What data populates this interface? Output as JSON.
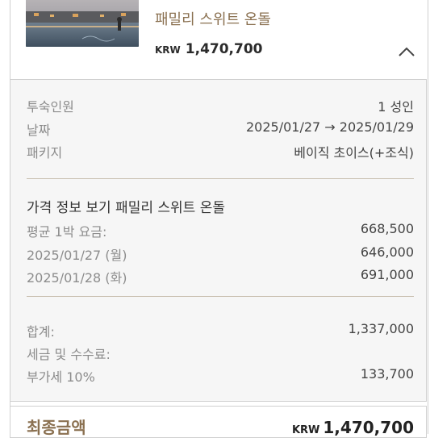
{
  "room": {
    "name": "패밀리 스위트 온돌",
    "currency": "KRW",
    "price": "1,470,700"
  },
  "summary": {
    "guests_label": "투숙인원",
    "guests_value": "1 성인",
    "date_label": "날짜",
    "date_value": "2025/01/27  → 2025/01/29",
    "package_label": "패키지",
    "package_value": "베이직 초이스(+조식)"
  },
  "price_info": {
    "title": "가격 정보 보기 패밀리 스위트 온돌",
    "avg_label": "평균 1박 요금:",
    "avg_value": "668,500",
    "nights": [
      {
        "date": "2025/01/27 (월)",
        "price": "646,000"
      },
      {
        "date": "2025/01/28 (화)",
        "price": "691,000"
      }
    ]
  },
  "totals": {
    "subtotal_label": "합계:",
    "subtotal_value": "1,337,000",
    "tax_label": "세금 및 수수료:",
    "vat_label": "부가세 10%",
    "vat_value": "133,700"
  },
  "final": {
    "label": "최종금액",
    "currency": "KRW",
    "value": "1,470,700"
  },
  "icons": {
    "collapse": "chevron-up-icon",
    "thumbnail": "hotel-pool-image"
  },
  "colors": {
    "accent": "#8a7050",
    "panel_bg": "#f6f6f6",
    "muted": "#8c8c8c"
  }
}
